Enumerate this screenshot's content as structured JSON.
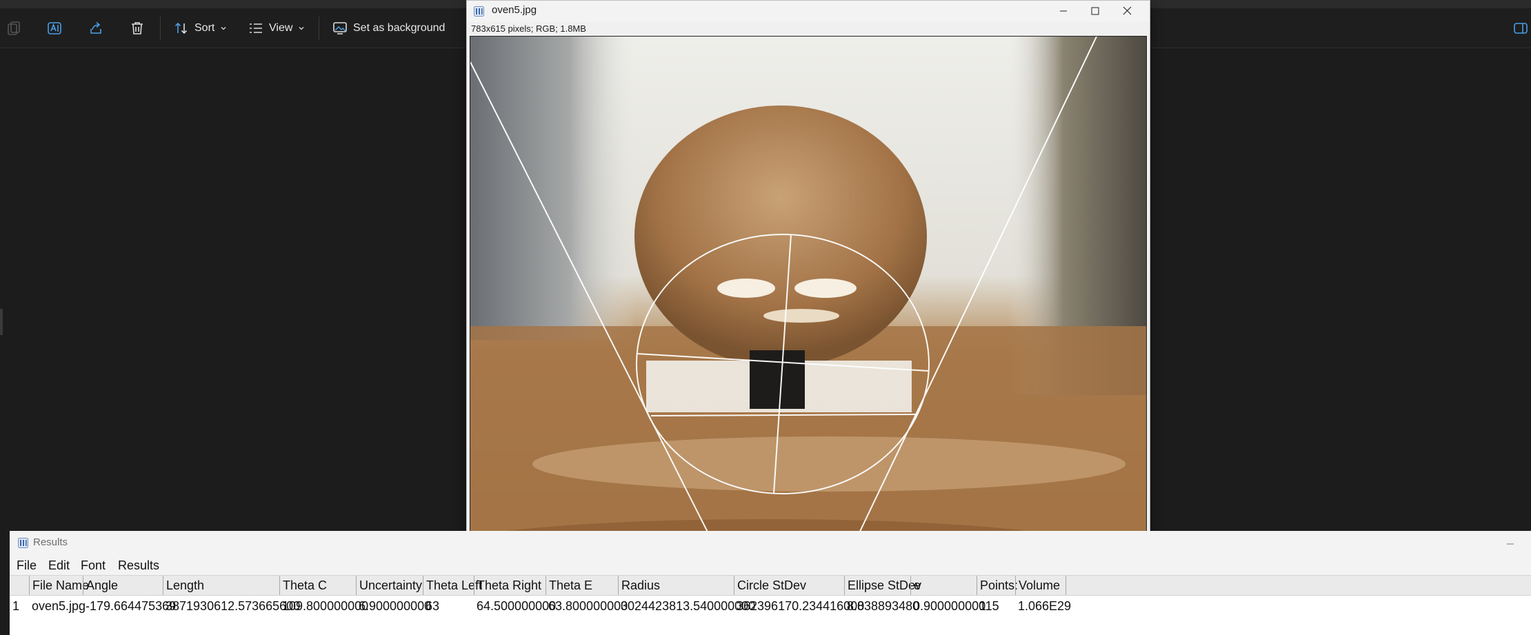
{
  "toolbar": {
    "items": [
      {
        "name": "copy",
        "label": ""
      },
      {
        "name": "rename",
        "label": ""
      },
      {
        "name": "share",
        "label": ""
      },
      {
        "name": "delete",
        "label": ""
      },
      {
        "name": "sort",
        "label": "Sort"
      },
      {
        "name": "view",
        "label": "View"
      },
      {
        "name": "set-background",
        "label": "Set as background"
      }
    ]
  },
  "image_window": {
    "title": "oven5.jpg",
    "info": "783x615 pixels; RGB; 1.8MB"
  },
  "results_window": {
    "title": "Results",
    "menu": [
      "File",
      "Edit",
      "Font",
      "Results"
    ],
    "columns": [
      "",
      "File Name",
      "Angle",
      "Length",
      "Theta C",
      "Uncertainty",
      "Theta Left",
      "Theta Right",
      "Theta E",
      "Radius",
      "Circle StDev",
      "Ellipse StDev",
      "e",
      "Points:",
      "Volume"
    ],
    "rows": [
      [
        "1",
        "oven5.jpg",
        "-179.664475369",
        "3871930612.573665600",
        "109.800000000",
        "6.900000000",
        "63",
        "64.500000000",
        "63.800000000",
        "3024423813.540000000",
        "362396170.234416000",
        "8.838893480",
        "0.900000000",
        "115",
        "1.066E29"
      ]
    ]
  },
  "colors": {
    "app_bg": "#1c1c1c",
    "accent_blue": "#4a9de8",
    "overlay_line": "#ffffff"
  },
  "icons": [
    "copy-icon",
    "rename-icon",
    "share-icon",
    "delete-icon",
    "sort-icon",
    "view-icon",
    "background-icon",
    "imagej-icon",
    "minimize-icon",
    "maximize-icon",
    "close-icon"
  ]
}
